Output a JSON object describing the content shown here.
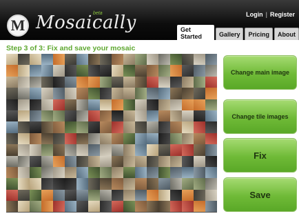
{
  "brand": {
    "name": "Mosaically",
    "beta": "beta",
    "logo_letter": "M"
  },
  "header": {
    "login": "Login",
    "separator": "|",
    "register": "Register"
  },
  "tabs": [
    {
      "label": "Get Started",
      "active": true
    },
    {
      "label": "Gallery",
      "active": false
    },
    {
      "label": "Pricing",
      "active": false
    },
    {
      "label": "About",
      "active": false
    }
  ],
  "step": {
    "title": "Step 3 of 3: Fix and save your mosaic"
  },
  "actions": {
    "change_main_image": "Change main image",
    "change_tile_images": "Change tile images",
    "fix": "Fix",
    "save": "Save"
  },
  "colors": {
    "accent_green": "#6fba37",
    "step_title_green": "#5fa831",
    "header_bg": "#0d0d0d"
  },
  "mosaic": {
    "columns": 18,
    "rows": 14
  }
}
